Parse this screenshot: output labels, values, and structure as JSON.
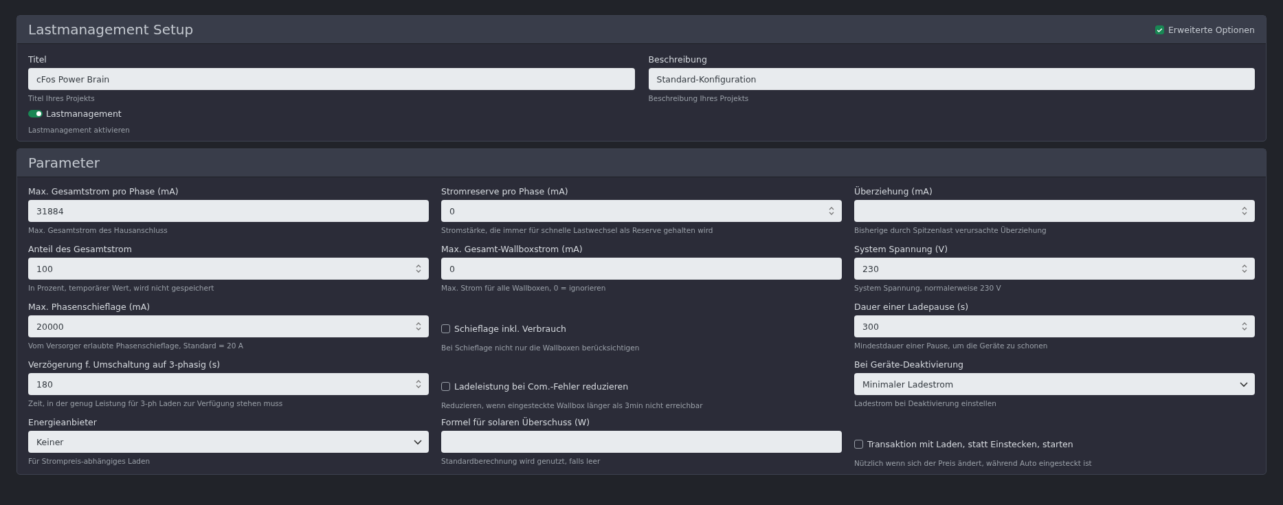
{
  "setup": {
    "title": "Lastmanagement Setup",
    "advanced": {
      "label": "Erweiterte Optionen",
      "checked": true
    },
    "fields": [
      {
        "label": "Titel",
        "value": "cFos Power Brain",
        "help": "Titel Ihres Projekts"
      },
      {
        "label": "Beschreibung",
        "value": "Standard-Konfiguration",
        "help": "Beschreibung Ihres Projekts"
      }
    ],
    "switch": {
      "label": "Lastmanagement",
      "on": true,
      "help": "Lastmanagement aktivieren"
    }
  },
  "parameters": {
    "title": "Parameter",
    "cells": [
      {
        "kind": "text",
        "label": "Max. Gesamtstrom pro Phase (mA)",
        "value": "31884",
        "help": "Max. Gesamtstrom des Hausanschluss"
      },
      {
        "kind": "number",
        "label": "Stromreserve pro Phase (mA)",
        "value": "0",
        "help": "Stromstärke, die immer für schnelle Lastwechsel als Reserve gehalten wird"
      },
      {
        "kind": "number",
        "label": "Überziehung (mA)",
        "help": "Bisherige durch Spitzenlast verursachte Überziehung"
      },
      {
        "kind": "number",
        "label": "Anteil des Gesamtstrom",
        "value": "100",
        "help": "In Prozent, temporärer Wert, wird nicht gespeichert"
      },
      {
        "kind": "text",
        "label": "Max. Gesamt-Wallboxstrom (mA)",
        "value": "0",
        "help": "Max. Strom für alle Wallboxen, 0 = ignorieren"
      },
      {
        "kind": "number",
        "label": "System Spannung (V)",
        "value": "230",
        "help": "System Spannung, normalerweise 230 V"
      },
      {
        "kind": "number",
        "label": "Max. Phasenschieflage (mA)",
        "value": "20000",
        "help": "Vom Versorger erlaubte Phasenschieflage, Standard = 20 A"
      },
      {
        "kind": "checkbox",
        "label": "Schieflage inkl. Verbrauch",
        "checked": false,
        "help": "Bei Schieflage nicht nur die Wallboxen berücksichtigen"
      },
      {
        "kind": "number",
        "label": "Dauer einer Ladepause (s)",
        "value": "300",
        "help": "Mindestdauer einer Pause, um die Geräte zu schonen"
      },
      {
        "kind": "number",
        "label": "Verzögerung f. Umschaltung auf 3-phasig (s)",
        "value": "180",
        "help": "Zeit, in der genug Leistung für 3-ph Laden zur Verfügung stehen muss"
      },
      {
        "kind": "checkbox",
        "label": "Ladeleistung bei Com.-Fehler reduzieren",
        "checked": false,
        "help": "Reduzieren, wenn eingesteckte Wallbox länger als 3min nicht erreichbar"
      },
      {
        "kind": "select",
        "label": "Bei Geräte-Deaktivierung",
        "value": "Minimaler Ladestrom",
        "help": "Ladestrom bei Deaktivierung einstellen"
      },
      {
        "kind": "select",
        "label": "Energieanbieter",
        "value": "Keiner",
        "help": "Für Strompreis-abhängiges Laden"
      },
      {
        "kind": "text",
        "label": "Formel für solaren Überschuss (W)",
        "help": "Standardberechnung wird genutzt, falls leer"
      },
      {
        "kind": "checkbox",
        "label": "Transaktion mit Laden, statt Einstecken, starten",
        "checked": false,
        "help": "Nützlich wenn sich der Preis ändert, während Auto eingesteckt ist"
      }
    ]
  }
}
